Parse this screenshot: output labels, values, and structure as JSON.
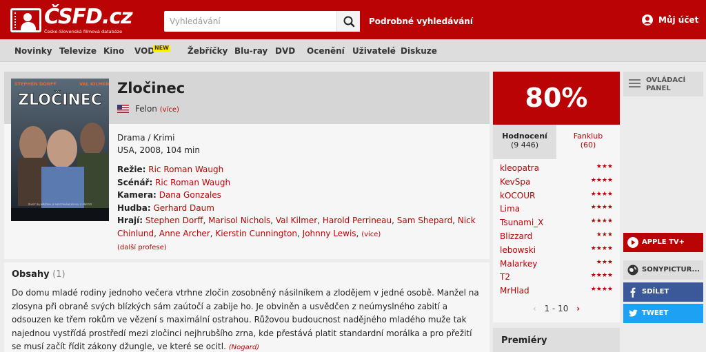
{
  "header": {
    "logo_text": "ČSFD.cz",
    "logo_subtitle": "Česko-Slovenská filmová databáze",
    "search_placeholder": "Vyhledávání",
    "advanced_search": "Podrobné vyhledávání",
    "account": "Můj účet"
  },
  "nav": {
    "items": [
      "Novinky",
      "Televize",
      "Kino",
      "VOD",
      "Žebříčky",
      "Blu-ray",
      "DVD",
      "Ocenění",
      "Uživatelé",
      "Diskuze"
    ],
    "vod_badge": "NEW"
  },
  "movie": {
    "poster_actors_left": "STEPHEN DORFF",
    "poster_actors_right": "VAL KILMER",
    "poster_title": "ZLOČINEC",
    "poster_tagline": "ŽIVOT ZA MŘÍŽEMI JE NEJSTRAŠNĚJŠÍ BOJ O PŘEŽITÍ",
    "title": "Zločinec",
    "original_title": "Felon",
    "original_more": "(více)",
    "genre": "Drama / Krimi",
    "origin": "USA, 2008, 104 min",
    "director_label": "Režie:",
    "director": "Ric Roman Waugh",
    "writer_label": "Scénář:",
    "writer": "Ric Roman Waugh",
    "camera_label": "Kamera:",
    "camera": "Dana Gonzales",
    "music_label": "Hudba:",
    "music": "Gerhard Daum",
    "cast_label": "Hrají:",
    "cast": [
      "Stephen Dorff",
      "Marisol Nichols",
      "Val Kilmer",
      "Harold Perrineau",
      "Sam Shepard",
      "Nick Chinlund",
      "Anne Archer",
      "Kierstin Cunnington",
      "Johnny Lewis"
    ],
    "cast_more": "(více)",
    "more_professions": "(další profese)"
  },
  "plot": {
    "heading": "Obsahy",
    "count": "(1)",
    "text": "Do domu mladé rodiny jednoho večera vtrhne zločin zosobněný násilníkem a zlodějem v jedné osobě. Manžel na zlosyna při obraně svých blízkých sám zaútočí a zabije ho. Je obviněn a usvědčen z neúmyslného zabití a odsouzen ke třem rokům ve vězení s maximální ostrahou. Růžovou budoucnost nadějného mladého muže tak najednou vystřídá prostředí mezi zločinci nejhrubšího zrna, kde přestává platit standardní morálka a pro přežití se musí začít řídit zákony džungle, ve které se ocitl.",
    "author": "(Nogard)"
  },
  "rating": {
    "percent": "80%",
    "tab_ratings": "Hodnocení",
    "tab_ratings_count": "(9 446)",
    "tab_fanclub": "Fanklub",
    "tab_fanclub_count": "(60)",
    "users": [
      {
        "name": "kleopatra",
        "stars": "★★★"
      },
      {
        "name": "KevSpa",
        "stars": "★★★★"
      },
      {
        "name": "kOCOUR",
        "stars": "★★★★"
      },
      {
        "name": "Lima",
        "stars": "★★★★"
      },
      {
        "name": "Tsunami_X",
        "stars": "★★★★"
      },
      {
        "name": "Blizzard",
        "stars": "★★★"
      },
      {
        "name": "lebowski",
        "stars": "★★★★"
      },
      {
        "name": "Malarkey",
        "stars": "★★★"
      },
      {
        "name": "T2",
        "stars": "★★★★"
      },
      {
        "name": "MrHlad",
        "stars": "★★★★"
      }
    ],
    "pager": "1 - 10",
    "pager_prev": "‹",
    "pager_next": "›",
    "premieres": "Premiéry"
  },
  "sidebar": {
    "control_panel": "OVLÁDACÍ PANEL",
    "apple_tv": "APPLE TV+",
    "sony": "SONYPICTUR...",
    "share": "SDÍLET",
    "tweet": "TWEET"
  },
  "colors": {
    "brand_red": "#ba0305",
    "facebook": "#3b5998",
    "twitter": "#1da1f2"
  }
}
